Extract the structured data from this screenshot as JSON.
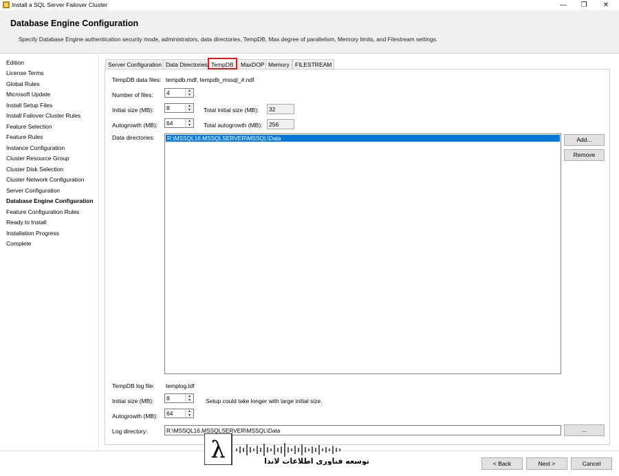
{
  "window": {
    "title": "Install a SQL Server Failover Cluster",
    "minimize": "—",
    "restore": "❐",
    "close": "✕"
  },
  "header": {
    "title": "Database Engine Configuration",
    "subtitle": "Specify Database Engine authentication security mode, administrators, data directories, TempDB, Max degree of parallelism, Memory limits, and Filestream settings."
  },
  "nav": {
    "items": [
      {
        "label": "Edition"
      },
      {
        "label": "License Terms"
      },
      {
        "label": "Global Rules"
      },
      {
        "label": "Microsoft Update"
      },
      {
        "label": "Install Setup Files"
      },
      {
        "label": "Install Failover Cluster Rules"
      },
      {
        "label": "Feature Selection"
      },
      {
        "label": "Feature Rules"
      },
      {
        "label": "Instance Configuration"
      },
      {
        "label": "Cluster Resource Group"
      },
      {
        "label": "Cluster Disk Selection"
      },
      {
        "label": "Cluster Network Configuration"
      },
      {
        "label": "Server Configuration"
      },
      {
        "label": "Database Engine Configuration",
        "active": true
      },
      {
        "label": "Feature Configuration Rules"
      },
      {
        "label": "Ready to Install"
      },
      {
        "label": "Installation Progress"
      },
      {
        "label": "Complete"
      }
    ]
  },
  "tabs": [
    {
      "label": "Server Configuration"
    },
    {
      "label": "Data Directories"
    },
    {
      "label": "TempDB",
      "active": true
    },
    {
      "label": "MaxDOP"
    },
    {
      "label": "Memory"
    },
    {
      "label": "FILESTREAM"
    }
  ],
  "tempdb": {
    "data_files_label": "TempDB data files:",
    "data_files_value": "tempdb.mdf, tempdb_mssql_#.ndf",
    "number_of_files_label": "Number of files:",
    "number_of_files_value": "4",
    "initial_size_label": "Initial size (MB):",
    "initial_size_value": "8",
    "total_initial_size_label": "Total initial size (MB):",
    "total_initial_size_value": "32",
    "autogrowth_label": "Autogrowth (MB):",
    "autogrowth_value": "64",
    "total_autogrowth_label": "Total autogrowth (MB):",
    "total_autogrowth_value": "256",
    "data_directories_label": "Data directories:",
    "data_directories": [
      "R:\\MSSQL16.MSSQLSERVER\\MSSQL\\Data"
    ],
    "add_button": "Add...",
    "remove_button": "Remove",
    "log_file_label": "TempDB log file:",
    "log_file_value": "templog.ldf",
    "log_initial_size_label": "Initial size (MB):",
    "log_initial_size_value": "8",
    "log_note": "Setup could take longer with large initial size.",
    "log_autogrowth_label": "Autogrowth (MB):",
    "log_autogrowth_value": "64",
    "log_directory_label": "Log directory:",
    "log_directory_value": "R:\\MSSQL16.MSSQLSERVER\\MSSQL\\Data",
    "browse_button": "..."
  },
  "footer": {
    "back": "< Back",
    "next": "Next >",
    "cancel": "Cancel"
  },
  "watermark": {
    "symbol": "λ",
    "text": "توسعه فناوری اطلاعات لاندا"
  }
}
